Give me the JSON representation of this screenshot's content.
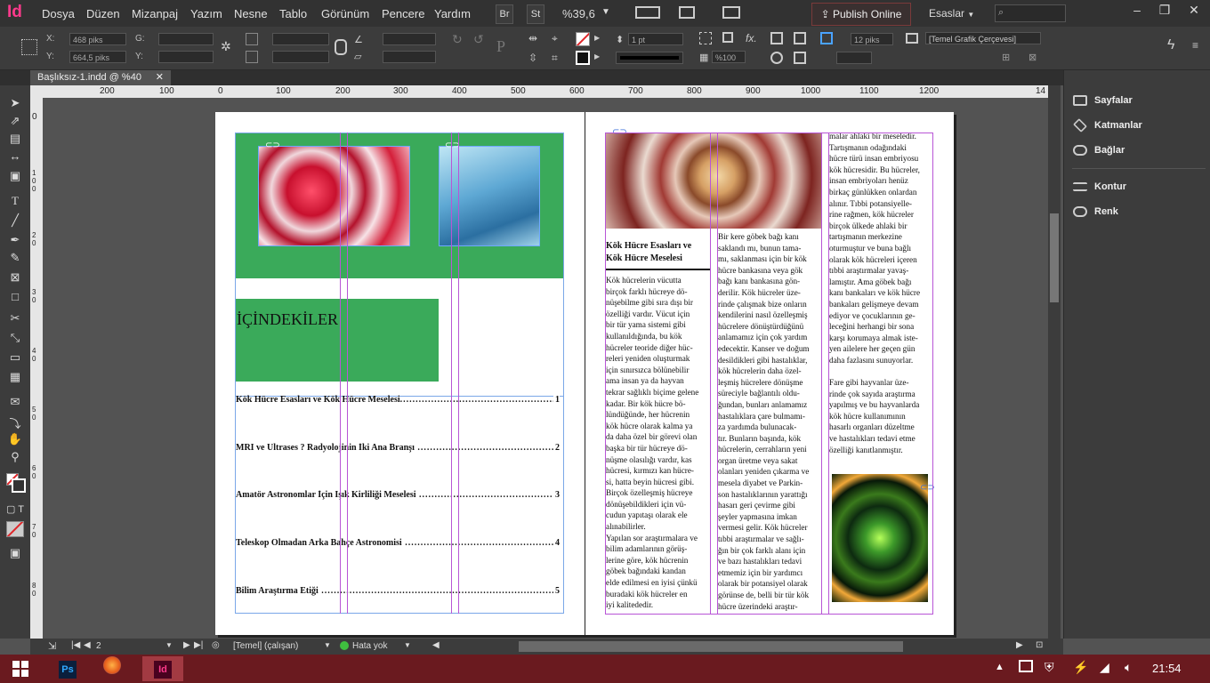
{
  "app": {
    "logo": "Id",
    "menus": [
      "Dosya",
      "Düzen",
      "Mizanpaj",
      "Yazım",
      "Nesne",
      "Tablo",
      "Görünüm",
      "Pencere",
      "Yardım"
    ],
    "br_label": "Br",
    "st_label": "St",
    "zoom": "%39,6",
    "publish_label": "Publish Online",
    "workspace": "Esaslar",
    "search_placeholder": "",
    "win_min": "–",
    "win_restore": "❐",
    "win_close": "✕"
  },
  "control": {
    "x_label": "X:",
    "x_value": "468 piks",
    "y_label": "Y:",
    "y_value": "664,5 piks",
    "g_label": "G:",
    "y2_label": "Y:",
    "stroke_weight": "1 pt",
    "opacity": "%100",
    "size_value": "12 piks",
    "frame_style": "[Temel Grafik Çerçevesi]"
  },
  "document": {
    "tab_title": "Başlıksız-1.indd @ %40",
    "tab_close": "✕"
  },
  "ruler": {
    "h_ticks": [
      "200",
      "100",
      "0",
      "100",
      "200",
      "300",
      "400",
      "500",
      "600",
      "700",
      "800",
      "900",
      "1000",
      "1100",
      "1200",
      "14"
    ],
    "v_ticks": [
      "0",
      "1 0 0",
      "2 0",
      "3 0",
      "4 0",
      "5 0",
      "6 0",
      "7 0",
      "8 0"
    ]
  },
  "left_page": {
    "contents_title": "İÇİNDEKİLER",
    "toc": [
      {
        "title": "Kök Hücre Esasları ve Kök Hücre Meselesi",
        "page": "1"
      },
      {
        "title": "MRI ve Ultrases ? Radyolojinin İki Ana Branşı",
        "page": "2"
      },
      {
        "title": "Amatör Astronomlar İçin Işık Kirliliği Meselesi",
        "page": "3"
      },
      {
        "title": "Teleskop Olmadan Arka Bahçe Astronomisi",
        "page": "4"
      },
      {
        "title": "Bilim Araştırma Etiği",
        "page": "5"
      }
    ]
  },
  "right_page": {
    "article_title_1": "Kök Hücre Esasları ve",
    "article_title_2": "Kök Hücre Meselesi",
    "col1": "Kök hücrelerin vücutta\nbirçok farklı hücreye dö-\nnüşebilme gibi sıra dışı bir\nözelliği vardır. Vücut için\nbir tür yama sistemi gibi\nkullanıldığında, bu kök\nhücreler teoride diğer hüc-\nreleri yeniden oluşturmak\niçin sınırsızca bölünebilir\nama insan ya da hayvan\ntekrar sağlıklı biçime gelene\nkadar. Bir kök hücre bö-\nlündüğünde, her hücrenin\nkök hücre olarak kalma ya\nda daha özel bir görevi olan\nbaşka bir tür hücreye dö-\nnüşme olasılığı vardır, kas\nhücresi, kırmızı kan hücre-\nsi, hatta beyin hücresi gibi.\nBirçok özelleşmiş hücreye\ndönüşebildikleri için vü-\ncudun yapıtaşı olarak ele\nalınabilirler.\nYapılan sor araştırmalara ve\nbilim adamlarının görüş-\nlerine göre, kök hücrenin\ngöbek bağındaki kandan\nelde edilmesi en iyisi çünkü\nburadaki kök hücreler en\niyi kalitededir.",
    "col2": "Bir kere göbek bağı kanı\nsaklandı mı, bunun tama-\nmı, saklanması için bir kök\nhücre bankasına veya gök\nbağı kanı bankasına gön-\nderilir. Kök hücreler üze-\nrinde çalışmak bize onların\nkendilerini nasıl özelleşmiş\nhücrelere dönüştürdüğünü\nanlamamız için çok yardım\nedecektir. Kanser ve doğum\ndesildikleri gibi hastalıklar,\nkök hücrelerin daha özel-\nleşmiş hücrelere dönüşme\nsüreciyle bağlantılı oldu-\nğundan, bunları anlamamız\nhastalıklara çare bulmamı-\nza yardımda bulunacak-\ntır. Bunların başında, kök\nhücrelerin, cerrahların yeni\norgan üretme veya sakat\nolanları yeniden çıkarma ve\nmesela diyabet ve Parkin-\nson hastalıklarının yarattığı\nhasarı geri çevirme gibi\nşeyler yapmasına imkan\nvermesi gelir. Kök hücreler\ntıbbi araştırmalar ve sağlı-\nğın bir çok farklı alanı için\nve bazı hastalıkları tedavi\netmemiz için bir yardımcı\nolarak bir potansiyel olarak\ngörünse de, belli bir tür kök\nhücre üzerindeki araştır-",
    "col3": "malar ahlaki bir meseledir.\nTartışmanın odağındaki\nhücre türü insan embriyosu\nkök hücresidir. Bu hücreler,\ninsan embriyoları henüz\nbirkaç günlükken onlardan\nalınır. Tıbbi potansiyelle-\nrine rağmen, kök hücreler\nbirçok ülkede ahlaki bir\ntartışmanın merkezine\noturmuştur ve buna bağlı\nolarak kök hücreleri içeren\ntıbbi araştırmalar yavaş-\nlamıştır. Ama göbek bağı\nkanı bankaları ve kök hücre\nbankaları gelişmeye devam\nediyor ve çocuklarının ge-\nleceğini herhangi bir sona\nkarşı korumaya almak iste-\nyen ailelere her geçen gün\ndaha fazlasını sunuyorlar.\n\nFare gibi hayvanlar üze-\nrinde çok sayıda araştırma\nyapılmış ve bu hayvanlarda\nkök hücre kullanımının\nhasarlı organları düzeltme\nve hastalıkları tedavi etme\nözelliği kanıtlanmıştır."
  },
  "panels": [
    "Sayfalar",
    "Katmanlar",
    "Bağlar",
    "Kontur",
    "Renk"
  ],
  "status": {
    "page_number": "2",
    "master": "[Temel] (çalışan)",
    "errors": "Hata yok"
  },
  "taskbar": {
    "ps_label": "Ps",
    "id_label": "Id",
    "time": "21:54"
  }
}
